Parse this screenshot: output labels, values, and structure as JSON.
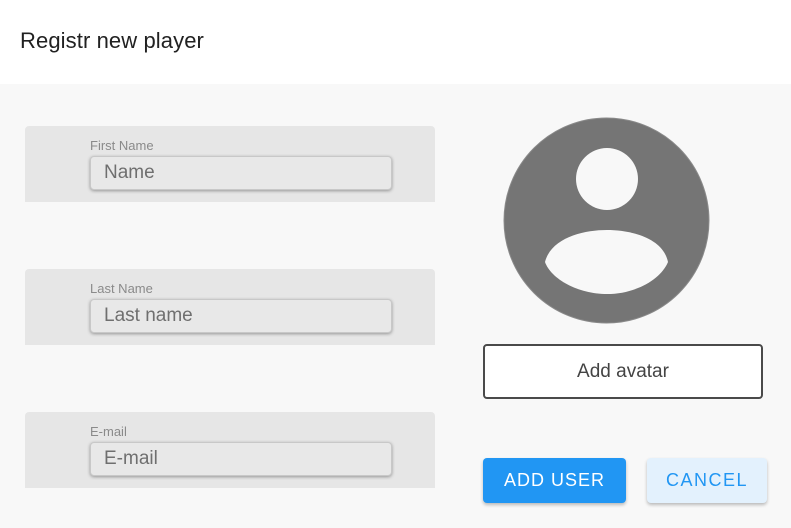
{
  "dialog": {
    "title": "Registr new player"
  },
  "form": {
    "first_name": {
      "label": "First Name",
      "placeholder": "Name"
    },
    "last_name": {
      "label": "Last Name",
      "placeholder": "Last name"
    },
    "email": {
      "label": "E-mail",
      "placeholder": "E-mail"
    }
  },
  "avatar": {
    "icon": "account-circle-icon",
    "add_label": "Add avatar"
  },
  "actions": {
    "add_user_label": "ADD USER",
    "cancel_label": "CANCEL"
  },
  "colors": {
    "primary": "#2196f3",
    "avatar_fill": "#757575",
    "cancel_bg": "#e3f1fd"
  }
}
